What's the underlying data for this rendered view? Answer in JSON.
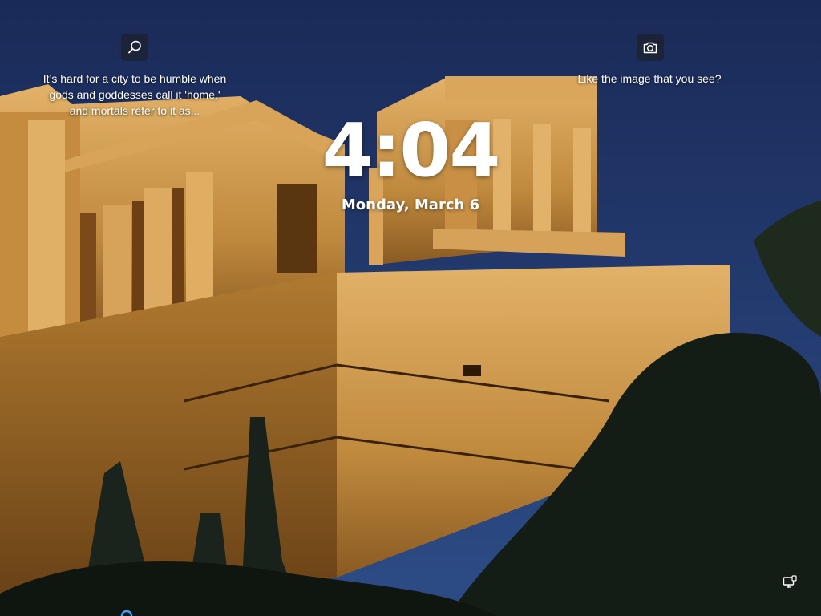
{
  "lockscreen": {
    "spotlight_left_text": "It’s hard for a city to be humble when gods and goddesses call it 'home,' and mortals refer to it as...",
    "spotlight_left_lines": [
      "It’s hard for a city to be humble when",
      "gods and goddesses call it 'home,'",
      "and mortals refer to it as..."
    ],
    "spotlight_right_text": "Like the image that you see?",
    "time": "4:04",
    "date": "Monday, March 6"
  },
  "icons": {
    "left_top": "search-icon",
    "right_top": "camera-icon",
    "bottom_right": "network-icon"
  },
  "colors": {
    "sky_top": "#1b2c5a",
    "sky_bottom": "#28467f",
    "stone_light": "#d9a55a",
    "stone_mid": "#b97e34",
    "stone_dark": "#6e4417",
    "foliage": "#121a14"
  }
}
